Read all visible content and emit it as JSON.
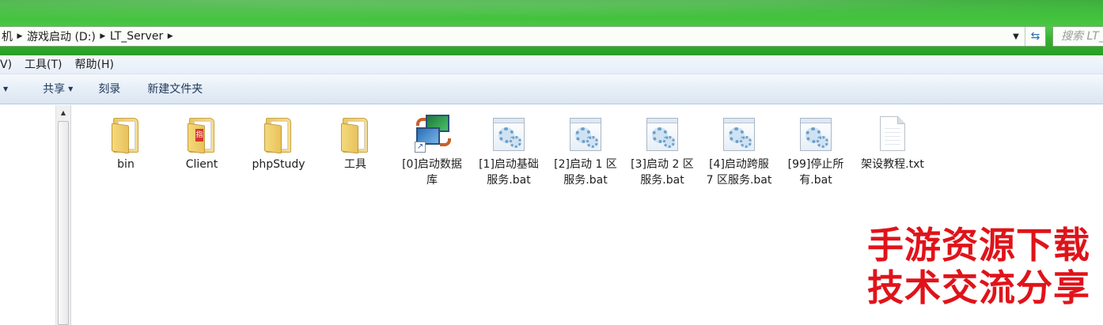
{
  "address": {
    "crumbs": [
      "机",
      "游戏启动 (D:)",
      "LT_Server"
    ],
    "search_placeholder": "搜索 LT_"
  },
  "menu": {
    "items": [
      "V)",
      "工具(T)",
      "帮助(H)"
    ]
  },
  "commands": {
    "share": "共享",
    "burn": "刻录",
    "new_folder": "新建文件夹"
  },
  "files": [
    {
      "name": "bin",
      "type": "folder"
    },
    {
      "name": "Client",
      "type": "folder"
    },
    {
      "name": "phpStudy",
      "type": "folder"
    },
    {
      "name": "工具",
      "type": "folder"
    },
    {
      "name": "[0]启动数据库",
      "type": "shortcut"
    },
    {
      "name": "[1]启动基础服务.bat",
      "type": "bat"
    },
    {
      "name": "[2]启动 1 区服务.bat",
      "type": "bat"
    },
    {
      "name": "[3]启动 2 区服务.bat",
      "type": "bat"
    },
    {
      "name": "[4]启动跨服 7 区服务.bat",
      "type": "bat"
    },
    {
      "name": "[99]停止所有.bat",
      "type": "bat"
    },
    {
      "name": "架设教程.txt",
      "type": "txt"
    }
  ],
  "watermark": {
    "line1": "手游资源下载",
    "line2": "技术交流分享"
  },
  "colors": {
    "title_green": "#3fbf3a",
    "watermark_red": "#e0131a"
  }
}
